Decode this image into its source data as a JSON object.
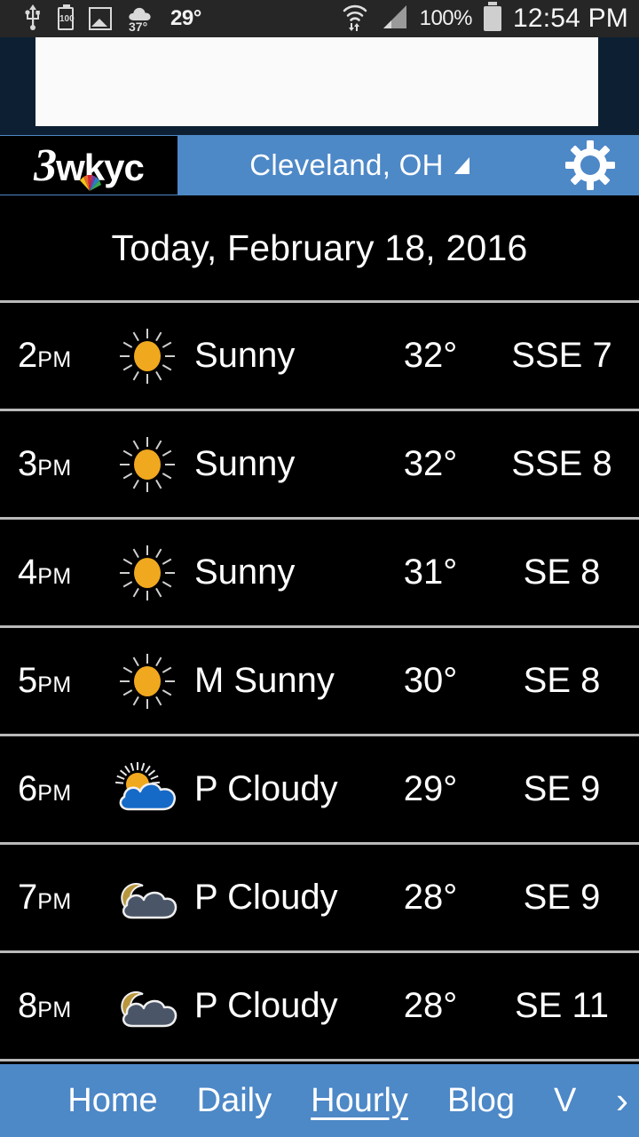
{
  "statusbar": {
    "usb_icon": "usb-icon",
    "battery_saver_label": "100",
    "photo_icon": "picture-icon",
    "weather_small_temp": "37°",
    "weather_temp": "29°",
    "wifi_icon": "wifi-icon",
    "signal_icon": "cellular-signal-icon",
    "battery_percent": "100%",
    "battery_icon": "battery-full-icon",
    "clock": "12:54 PM"
  },
  "header": {
    "logo_channel": "3",
    "logo_callsign": "wkyc",
    "location": "Cleveland, OH",
    "dropdown_icon": "chevron-down-icon",
    "settings_icon": "gear-icon"
  },
  "page_title": "Today, February 18, 2016",
  "forecast": {
    "rows": [
      {
        "time": "2",
        "meridiem": "PM",
        "icon": "sunny-icon",
        "condition": "Sunny",
        "temp": "32°",
        "wind": "SSE 7"
      },
      {
        "time": "3",
        "meridiem": "PM",
        "icon": "sunny-icon",
        "condition": "Sunny",
        "temp": "32°",
        "wind": "SSE 8"
      },
      {
        "time": "4",
        "meridiem": "PM",
        "icon": "sunny-icon",
        "condition": "Sunny",
        "temp": "31°",
        "wind": "SE 8"
      },
      {
        "time": "5",
        "meridiem": "PM",
        "icon": "sunny-icon",
        "condition": "M Sunny",
        "temp": "30°",
        "wind": "SE 8"
      },
      {
        "time": "6",
        "meridiem": "PM",
        "icon": "sun-cloud-icon",
        "condition": "P Cloudy",
        "temp": "29°",
        "wind": "SE 9"
      },
      {
        "time": "7",
        "meridiem": "PM",
        "icon": "moon-cloud-icon",
        "condition": "P Cloudy",
        "temp": "28°",
        "wind": "SE 9"
      },
      {
        "time": "8",
        "meridiem": "PM",
        "icon": "moon-cloud-icon",
        "condition": "P Cloudy",
        "temp": "28°",
        "wind": "SE 11"
      }
    ]
  },
  "nav": {
    "items": [
      {
        "label": "Home",
        "active": false
      },
      {
        "label": "Daily",
        "active": false
      },
      {
        "label": "Hourly",
        "active": true
      },
      {
        "label": "Blog",
        "active": false
      },
      {
        "label": "V",
        "active": false
      }
    ],
    "more_icon": "chevron-right-icon"
  },
  "colors": {
    "accent_blue": "#4d88c7",
    "background": "#000000",
    "sun_yellow": "#f0a81e",
    "cloud_blue": "#1569c7",
    "night_cloud": "#4a5568",
    "moon_gold": "#b8963c",
    "divider": "#b9b9b9",
    "statusbar": "#262626",
    "ad_backdrop": "#0d2033"
  }
}
